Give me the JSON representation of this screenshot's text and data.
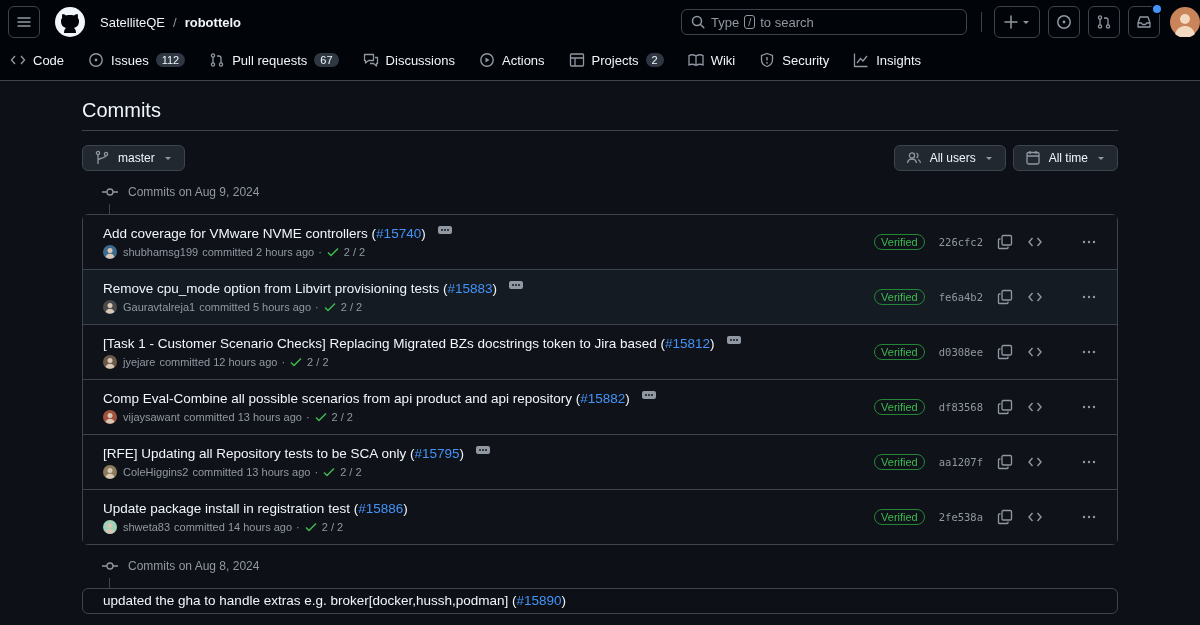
{
  "header": {
    "owner": "SatelliteQE",
    "repo": "robottelo",
    "separator": "/",
    "search_placeholder_before": "Type",
    "search_key": "/",
    "search_placeholder_after": "to search",
    "notifications_unread": true
  },
  "nav": [
    {
      "kind": "code",
      "label": "Code"
    },
    {
      "kind": "issues",
      "label": "Issues",
      "count": "112"
    },
    {
      "kind": "pulls",
      "label": "Pull requests",
      "count": "67"
    },
    {
      "kind": "discussions",
      "label": "Discussions"
    },
    {
      "kind": "actions",
      "label": "Actions"
    },
    {
      "kind": "projects",
      "label": "Projects",
      "count": "2"
    },
    {
      "kind": "wiki",
      "label": "Wiki"
    },
    {
      "kind": "security",
      "label": "Security"
    },
    {
      "kind": "insights",
      "label": "Insights"
    }
  ],
  "page_title": "Commits",
  "branch": "master",
  "filters": [
    {
      "kind": "users",
      "label": "All users"
    },
    {
      "kind": "time",
      "label": "All time"
    }
  ],
  "groups": [
    {
      "heading": "Commits on Aug 9, 2024",
      "commits": [
        {
          "title_before": "Add coverage for VMware NVME controllers (",
          "pr": "#15740",
          "title_after": ")",
          "has_description": true,
          "author": "shubhamsg199",
          "time": "committed 2 hours ago",
          "separator": "·",
          "checks": "2 / 2",
          "verified": "Verified",
          "sha": "226cfc2",
          "hovered": false
        },
        {
          "title_before": "Remove cpu_mode option from Libvirt provisioning tests (",
          "pr": "#15883",
          "title_after": ")",
          "has_description": true,
          "author": "Gauravtalreja1",
          "time": "committed 5 hours ago",
          "separator": "·",
          "checks": "2 / 2",
          "verified": "Verified",
          "sha": "fe6a4b2",
          "hovered": true
        },
        {
          "title_before": "[Task 1 - Customer Scenario Checks] Replacing Migrated BZs docstrings token to Jira based (",
          "pr": "#15812",
          "title_after": ")",
          "has_description": true,
          "author": "jyejare",
          "time": "committed 12 hours ago",
          "separator": "·",
          "checks": "2 / 2",
          "verified": "Verified",
          "sha": "d0308ee",
          "hovered": false
        },
        {
          "title_before": "Comp Eval-Combine all possible scenarios from api product and api repository (",
          "pr": "#15882",
          "title_after": ")",
          "has_description": true,
          "author": "vijaysawant",
          "time": "committed 13 hours ago",
          "separator": "·",
          "checks": "2 / 2",
          "verified": "Verified",
          "sha": "df83568",
          "hovered": false
        },
        {
          "title_before": "[RFE] Updating all Repository tests to be SCA only (",
          "pr": "#15795",
          "title_after": ")",
          "has_description": true,
          "author": "ColeHiggins2",
          "time": "committed 13 hours ago",
          "separator": "·",
          "checks": "2 / 2",
          "verified": "Verified",
          "sha": "aa1207f",
          "hovered": false
        },
        {
          "title_before": "Update package install in registration test (",
          "pr": "#15886",
          "title_after": ")",
          "has_description": false,
          "author": "shweta83",
          "time": "committed 14 hours ago",
          "separator": "·",
          "checks": "2 / 2",
          "verified": "Verified",
          "sha": "2fe538a",
          "hovered": false
        }
      ]
    },
    {
      "heading": "Commits on Aug 8, 2024",
      "commits": [
        {
          "title_before": "updated the gha to handle extras e.g. broker[docker,hussh,podman] (",
          "pr": "#15890",
          "title_after": ")"
        }
      ]
    }
  ]
}
